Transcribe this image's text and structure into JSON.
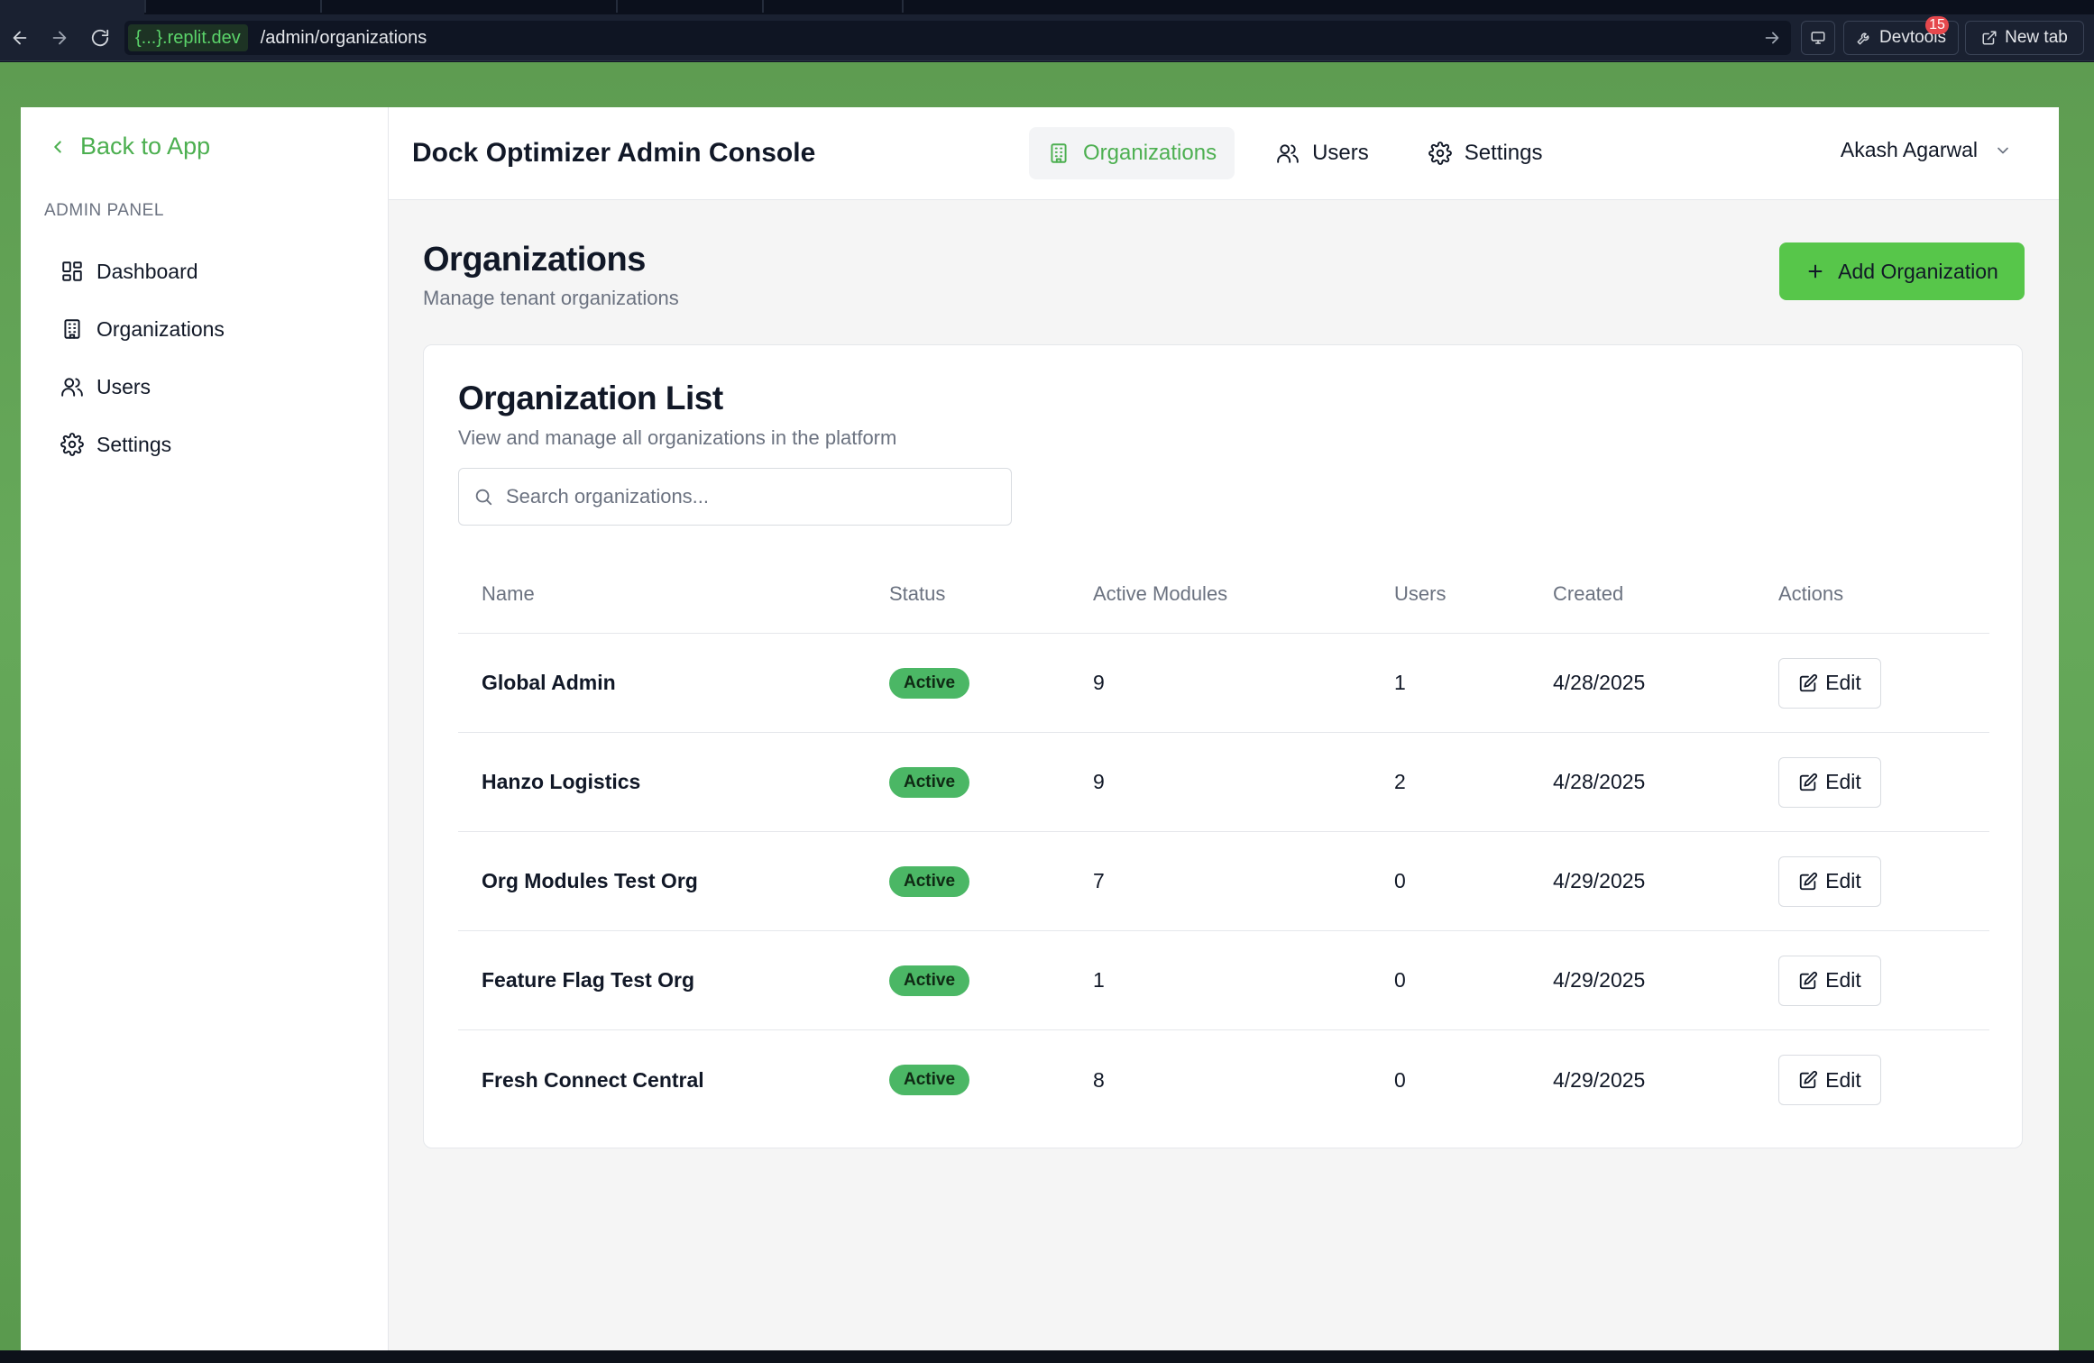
{
  "browser": {
    "host": "{...}.replit.dev",
    "path": "/admin/organizations",
    "devtools_label": "Devtools",
    "devtools_badge": "15",
    "newtab_label": "New tab"
  },
  "sidebar": {
    "back_label": "Back to App",
    "section_label": "ADMIN PANEL",
    "items": [
      {
        "label": "Dashboard",
        "icon": "dashboard-icon"
      },
      {
        "label": "Organizations",
        "icon": "building-icon"
      },
      {
        "label": "Users",
        "icon": "users-icon"
      },
      {
        "label": "Settings",
        "icon": "gear-icon"
      }
    ]
  },
  "header": {
    "title": "Dock Optimizer Admin Console",
    "nav": [
      {
        "label": "Organizations",
        "icon": "building-icon",
        "active": true
      },
      {
        "label": "Users",
        "icon": "users-icon",
        "active": false
      },
      {
        "label": "Settings",
        "icon": "gear-icon",
        "active": false
      }
    ],
    "user_name": "Akash Agarwal"
  },
  "page": {
    "title": "Organizations",
    "subtitle": "Manage tenant organizations",
    "add_button_label": "Add Organization"
  },
  "card": {
    "title": "Organization List",
    "subtitle": "View and manage all organizations in the platform",
    "search_placeholder": "Search organizations..."
  },
  "table": {
    "columns": [
      "Name",
      "Status",
      "Active Modules",
      "Users",
      "Created",
      "Actions"
    ],
    "rows": [
      {
        "name": "Global Admin",
        "status": "Active",
        "modules": "9",
        "users": "1",
        "created": "4/28/2025",
        "action": "Edit"
      },
      {
        "name": "Hanzo Logistics",
        "status": "Active",
        "modules": "9",
        "users": "2",
        "created": "4/28/2025",
        "action": "Edit"
      },
      {
        "name": "Org Modules Test Org",
        "status": "Active",
        "modules": "7",
        "users": "0",
        "created": "4/29/2025",
        "action": "Edit"
      },
      {
        "name": "Feature Flag Test Org",
        "status": "Active",
        "modules": "1",
        "users": "0",
        "created": "4/29/2025",
        "action": "Edit"
      },
      {
        "name": "Fresh Connect Central",
        "status": "Active",
        "modules": "8",
        "users": "0",
        "created": "4/29/2025",
        "action": "Edit"
      }
    ]
  },
  "colors": {
    "accent": "#4caf50",
    "button_green": "#57c64a",
    "status_active": "#4bb765",
    "page_background": "#66a95a"
  }
}
